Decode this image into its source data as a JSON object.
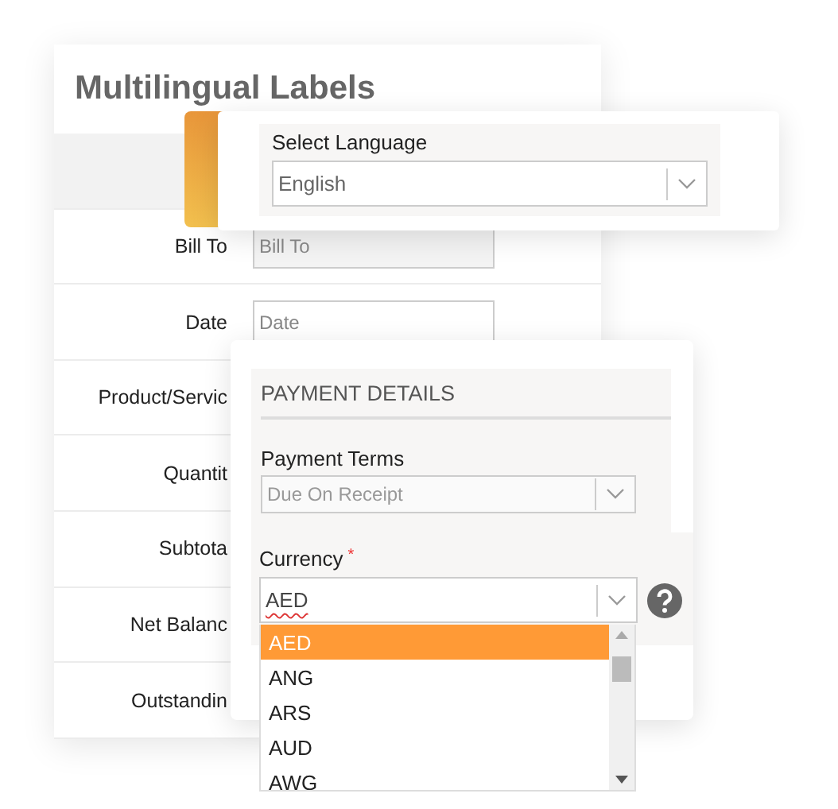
{
  "title": "Multilingual Labels",
  "label_rows": [
    {
      "highlighted": true
    },
    {
      "label": "Bill To",
      "placeholder": "Bill To",
      "highlighted": false
    },
    {
      "label": "Date",
      "placeholder": "Date",
      "highlighted": false
    },
    {
      "label": "Product/Servic",
      "highlighted": false
    },
    {
      "label": "Quantit",
      "highlighted": false
    },
    {
      "label": "Subtota",
      "highlighted": false
    },
    {
      "label": "Net Balanc",
      "highlighted": false
    },
    {
      "label": "Outstandin",
      "highlighted": false
    }
  ],
  "language": {
    "label": "Select Language",
    "value": "English"
  },
  "payment": {
    "heading": "PAYMENT DETAILS",
    "terms_label": "Payment Terms",
    "terms_value": "Due On Receipt",
    "currency_label": "Currency",
    "required_mark": "*",
    "currency_value": "AED",
    "options": [
      {
        "label": "AED",
        "selected": true
      },
      {
        "label": "ANG",
        "selected": false
      },
      {
        "label": "ARS",
        "selected": false
      },
      {
        "label": "AUD",
        "selected": false
      },
      {
        "label": "AWG",
        "selected": false
      }
    ]
  }
}
